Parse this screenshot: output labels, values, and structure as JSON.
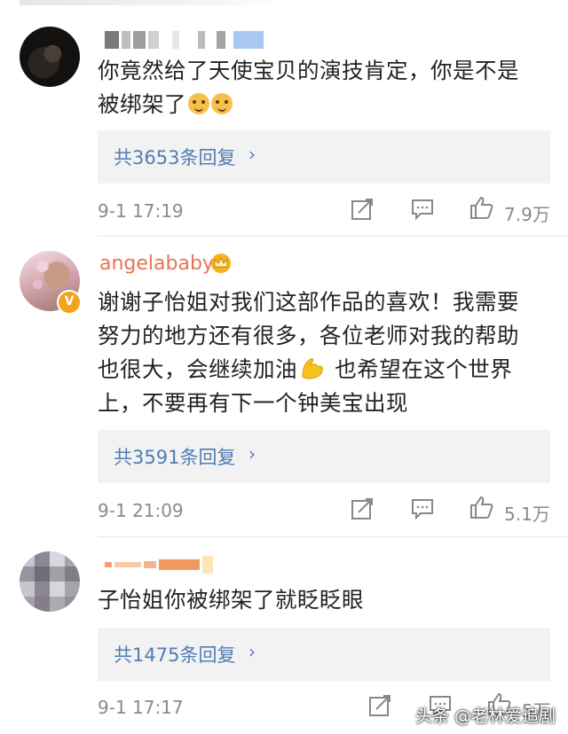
{
  "comments": [
    {
      "username": "",
      "text_line1": "你竟然给了天使宝贝的演技肯定，你是不是",
      "text_line2": "被绑架了",
      "emoji_icon": "doge-emoji-icon",
      "reply_label": "共3653条回复",
      "time": "9-1 17:19",
      "likes": "7.9万"
    },
    {
      "username": "angelababy",
      "badge": "V",
      "text_line1": "谢谢子怡姐对我们这部作品的喜欢！我需要",
      "text_line2": "努力的地方还有很多，各位老师对我的帮助",
      "text_line3a": "也很大，会继续加油",
      "text_line3b": " 也希望在这个世界",
      "text_line4": "上，不要再有下一个钟美宝出现",
      "reply_label": "共3591条回复",
      "time": "9-1 21:09",
      "likes": "5.1万"
    },
    {
      "username": "",
      "text_line1": "子怡姐你被绑架了就眨眨眼",
      "reply_label": "共1475条回复",
      "time": "9-1 17:17",
      "likes": "5万"
    }
  ],
  "reply_arrow": "›",
  "watermark": "头条 @老林爱追剧",
  "colors": {
    "link": "#4f7db5",
    "username": "#eb7350",
    "meta": "#8a8a8a"
  }
}
